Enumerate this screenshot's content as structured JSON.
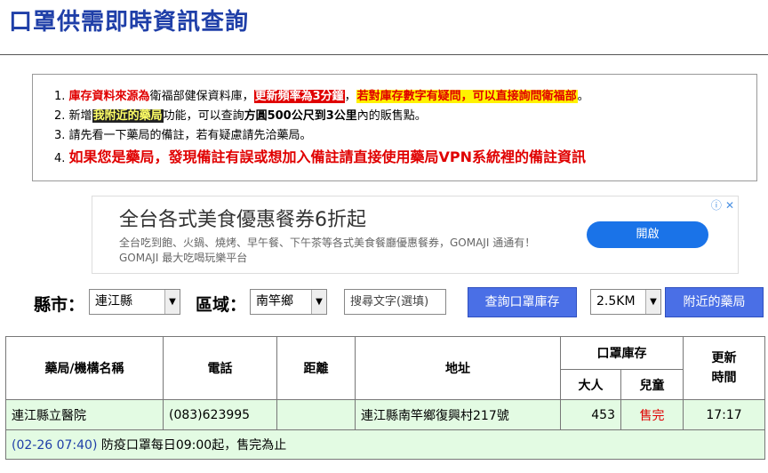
{
  "page": {
    "title": "口罩供需即時資訊查詢"
  },
  "notice": {
    "item1": {
      "num": "1.",
      "part1": "庫存資料來源為",
      "part2": "衛福部健保資料庫，",
      "part3": "更新頻率為3分鐘",
      "part4": "，",
      "part5": "若對庫存數字有疑問，可以直接詢問衛福部",
      "part6": "。"
    },
    "item2": {
      "num": "2.",
      "part1": "新增",
      "part2": "我附近的藥局",
      "part3": "功能，可以查詢",
      "part4": "方圓500公尺到3公里",
      "part5": "內的販售點。"
    },
    "item3": {
      "num": "3.",
      "text": "請先看一下藥局的備註，若有疑慮請先洽藥局。"
    },
    "item4": {
      "num": "4.",
      "text": "如果您是藥局，發現備註有誤或想加入備註請直接使用藥局VPN系統裡的備註資訊"
    }
  },
  "ad": {
    "title": "全台各式美食優惠餐券6折起",
    "desc": "全台吃到飽、火鍋、燒烤、早午餐、下午茶等各式美食餐廳優惠餐券，GOMAJI 通通有！ GOMAJI 最大吃喝玩樂平台",
    "button": "開啟",
    "info_icon": "ⓘ",
    "close_icon": "✕"
  },
  "filters": {
    "county_label": "縣市：",
    "county_value": "連江縣",
    "area_label": "區域：",
    "area_value": "南竿鄉",
    "search_placeholder": "搜尋文字(選填)",
    "query_button": "查詢口罩庫存",
    "distance_value": "2.5KM",
    "nearby_button": "附近的藥局"
  },
  "table": {
    "headers": {
      "name": "藥局/機構名稱",
      "phone": "電話",
      "distance": "距離",
      "address": "地址",
      "stock": "口罩庫存",
      "adult": "大人",
      "child": "兒童",
      "updated": "更新\n時間"
    },
    "rows": [
      {
        "name": "連江縣立醫院",
        "phone": "(083)623995",
        "distance": "",
        "address": "連江縣南竿鄉復興村217號",
        "adult": "453",
        "child": "售完",
        "updated": "17:17",
        "note_time": "(02-26 07:40)",
        "note_text": " 防疫口罩每日09:00起，售完為止"
      }
    ]
  },
  "colors": {
    "title": "#1f3fa8",
    "button": "#4a6fe6",
    "row_bg": "#e3fbe3",
    "alert_red": "#e00000"
  }
}
